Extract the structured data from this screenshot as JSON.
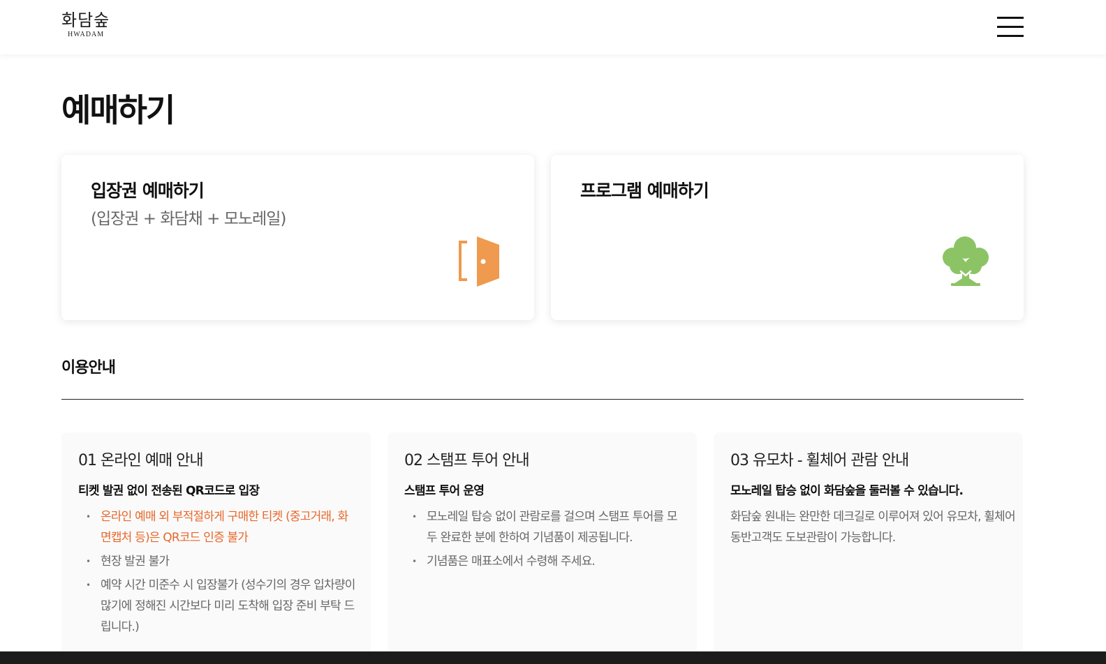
{
  "header": {
    "logo_kr": "화담숲",
    "logo_en": "HWADAM",
    "menu_icon": "hamburger-menu-icon"
  },
  "page": {
    "title": "예매하기"
  },
  "cards": {
    "ticket": {
      "title": "입장권 예매하기",
      "subtitle": "(입장권 + 화담채 + 모노레일)",
      "icon": "door-icon",
      "icon_color": "#ef9a4e"
    },
    "program": {
      "title": "프로그램 예매하기",
      "icon": "tree-icon",
      "icon_color": "#8cc465"
    }
  },
  "guide": {
    "section_title": "이용안내",
    "items": [
      {
        "heading": "01 온라인 예매 안내",
        "subheading": "티켓 발권 없이 전송된 QR코드로 입장",
        "bullets": [
          "온라인 예매 외 부적절하게 구매한 티켓 (중고거래, 화면캡처 등)은 QR코드 인증 불가",
          "현장 발권 불가",
          "예약 시간 미준수 시 입장불가 (성수기의 경우 입차량이 많기에 정해진 시간보다 미리 도착해 입장 준비 부탁 드립니다.)"
        ]
      },
      {
        "heading": "02 스탬프 투어 안내",
        "subheading": "스탬프 투어 운영",
        "bullets": [
          "모노레일 탑승 없이 관람로를 걸으며 스탬프 투어를 모두 완료한 분에 한하여 기념품이 제공됩니다.",
          "기념품은 매표소에서 수령해 주세요."
        ]
      },
      {
        "heading": "03 유모차 - 휠체어 관람 안내",
        "subheading": "모노레일 탑승 없이 화담숲을 둘러볼 수 있습니다.",
        "body": "화담숲 원내는 완만한 데크길로 이루어져 있어 유모차, 휠체어동반고객도 도보관람이 가능합니다."
      }
    ]
  },
  "colors": {
    "warning": "#e8672a",
    "text_muted": "#666666",
    "card_bg": "#fafafa"
  }
}
